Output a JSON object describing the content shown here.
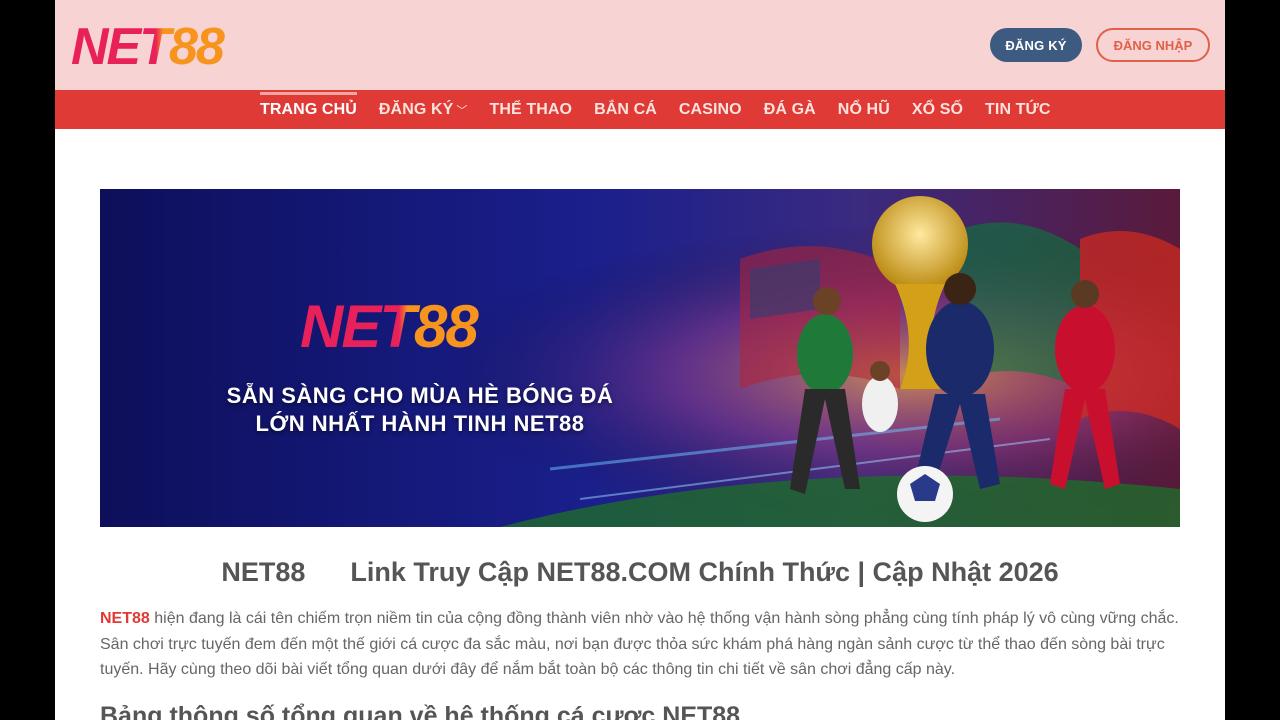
{
  "header": {
    "logo_text": "NET88",
    "register_label": "ĐĂNG KÝ",
    "login_label": "ĐĂNG NHẬP"
  },
  "nav": {
    "items": [
      {
        "label": "TRANG CHỦ",
        "active": true
      },
      {
        "label": "ĐĂNG KÝ",
        "has_dropdown": true
      },
      {
        "label": "THỂ THAO"
      },
      {
        "label": "BẮN CÁ"
      },
      {
        "label": "CASINO"
      },
      {
        "label": "ĐÁ GÀ"
      },
      {
        "label": "NỔ HŨ"
      },
      {
        "label": "XỔ SỐ"
      },
      {
        "label": "TIN TỨC"
      }
    ],
    "chevron_icon": "chevron-down-icon"
  },
  "banner": {
    "brand": "NET88",
    "line1": "SẴN SÀNG CHO MÙA HÈ BÓNG ĐÁ",
    "line2": "LỚN NHẤT HÀNH TINH NET88"
  },
  "article": {
    "title_brand": "NET88",
    "title_rest": "Link Truy Cập NET88.COM Chính Thức | Cập Nhật 2026",
    "intro_brand": "NET88",
    "intro_text": " hiện đang là cái tên chiếm trọn niềm tin của cộng đồng thành viên nhờ vào hệ thống vận hành sòng phẳng cùng tính pháp lý vô cùng vững chắc. Sân chơi trực tuyến đem đến một thế giới cá cược đa sắc màu, nơi bạn được thỏa sức khám phá hàng ngàn sảnh cược từ thể thao đến sòng bài trực tuyến. Hãy cùng theo dõi bài viết tổng quan dưới đây để nắm bắt toàn bộ các thông tin chi tiết về sân chơi đẳng cấp này.",
    "subheading": "Bảng thông số tổng quan về hệ thống cá cược NET88"
  },
  "colors": {
    "header_bg": "#f7d3d3",
    "nav_bg": "#e03a36",
    "register_bg": "#3d5a80",
    "login_border": "#e0614a",
    "brand_red": "#e03a36",
    "logo_pink": "#e8215a",
    "logo_orange": "#f7941d"
  }
}
